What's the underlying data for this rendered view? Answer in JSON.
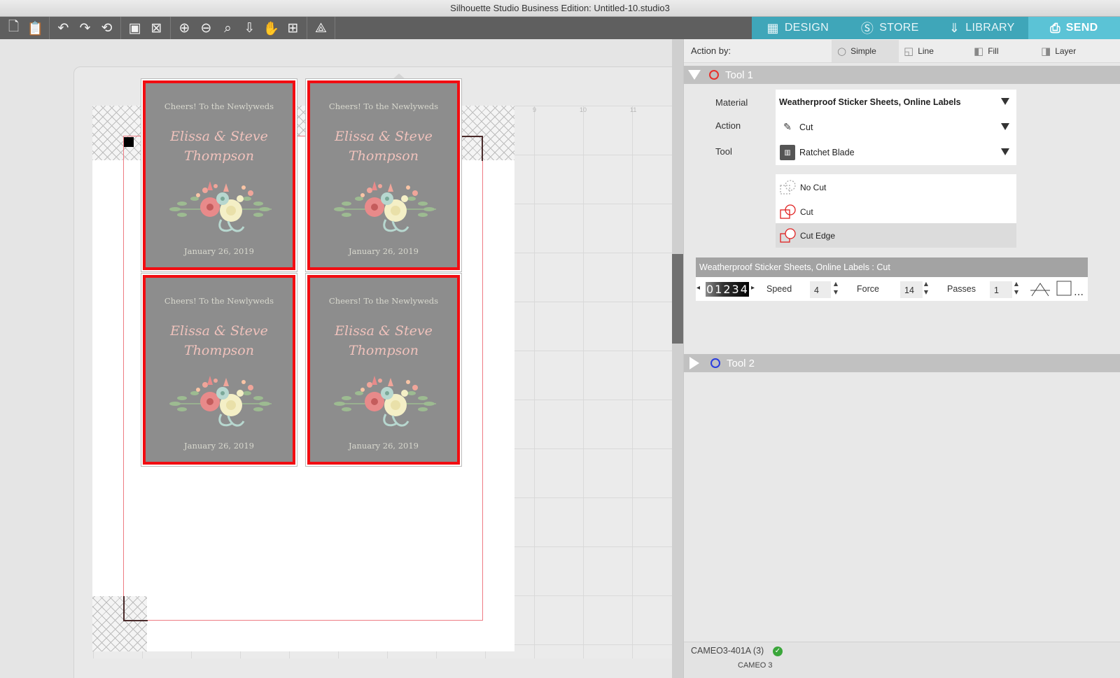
{
  "window": {
    "title": "Silhouette Studio Business Edition: Untitled-10.studio3"
  },
  "toolbar": {
    "groups": [
      [
        {
          "icon": "new-document-icon",
          "glyph": "🗋"
        },
        {
          "icon": "clipboard-icon",
          "glyph": "📋"
        }
      ],
      [
        {
          "icon": "undo-icon",
          "glyph": "↶"
        },
        {
          "icon": "redo-icon",
          "glyph": "↷"
        },
        {
          "icon": "refresh-icon",
          "glyph": "⟲"
        }
      ],
      [
        {
          "icon": "select-all-icon",
          "glyph": "▣"
        },
        {
          "icon": "deselect-icon",
          "glyph": "⊠"
        }
      ],
      [
        {
          "icon": "zoom-in-icon",
          "glyph": "⊕"
        },
        {
          "icon": "zoom-out-icon",
          "glyph": "⊖"
        },
        {
          "icon": "zoom-selection-icon",
          "glyph": "⌕"
        },
        {
          "icon": "move-down-icon",
          "glyph": "⇩"
        },
        {
          "icon": "pan-hand-icon",
          "glyph": "✋"
        },
        {
          "icon": "fit-to-page-icon",
          "glyph": "⊞"
        }
      ],
      [
        {
          "icon": "pixscan-icon",
          "glyph": "⟁"
        }
      ]
    ]
  },
  "nav_tabs": [
    {
      "label": "DESIGN",
      "icon": "design-grid-icon",
      "glyph": "▦",
      "active": false
    },
    {
      "label": "STORE",
      "icon": "store-s-icon",
      "glyph": "Ⓢ",
      "active": false
    },
    {
      "label": "LIBRARY",
      "icon": "library-download-icon",
      "glyph": "⇓",
      "active": false
    },
    {
      "label": "SEND",
      "icon": "send-cutter-icon",
      "glyph": "⎙",
      "active": true
    }
  ],
  "ruler": {
    "numbers": [
      "9",
      "10",
      "11"
    ]
  },
  "sticker": {
    "top_text": "Cheers! To the Newlyweds",
    "names_line1": "Elissa & Steve",
    "names_line2": "Thompson",
    "date": "January 26, 2019"
  },
  "panel": {
    "action_by_label": "Action by:",
    "action_by_tabs": [
      {
        "label": "Simple",
        "icon": "radio-icon",
        "glyph": "○",
        "active": true
      },
      {
        "label": "Line",
        "icon": "line-mode-icon",
        "glyph": "◱",
        "active": false
      },
      {
        "label": "Fill",
        "icon": "fill-mode-icon",
        "glyph": "◧",
        "active": false
      },
      {
        "label": "Layer",
        "icon": "layer-mode-icon",
        "glyph": "◨",
        "active": false
      }
    ],
    "tool1": {
      "label": "Tool 1",
      "color": "#e8312b",
      "material_label": "Material",
      "material_value": "Weatherproof Sticker Sheets, Online Labels",
      "action_label": "Action",
      "action_value": "Cut",
      "tool_label": "Tool",
      "tool_value": "Ratchet Blade",
      "cut_styles": [
        {
          "label": "No Cut",
          "icon": "no-cut-icon",
          "active": false
        },
        {
          "label": "Cut",
          "icon": "cut-icon",
          "active": false
        },
        {
          "label": "Cut Edge",
          "icon": "cut-edge-icon",
          "active": true
        }
      ]
    },
    "summary": "Weatherproof Sticker Sheets, Online Labels : Cut",
    "params": {
      "blade_digits": "01234",
      "speed_label": "Speed",
      "speed_value": "4",
      "force_label": "Force",
      "force_value": "14",
      "passes_label": "Passes",
      "passes_value": "1"
    },
    "tool2": {
      "label": "Tool 2",
      "color": "#2b3de0"
    },
    "device": {
      "name": "CAMEO3-401A (3)",
      "model": "CAMEO 3"
    }
  }
}
